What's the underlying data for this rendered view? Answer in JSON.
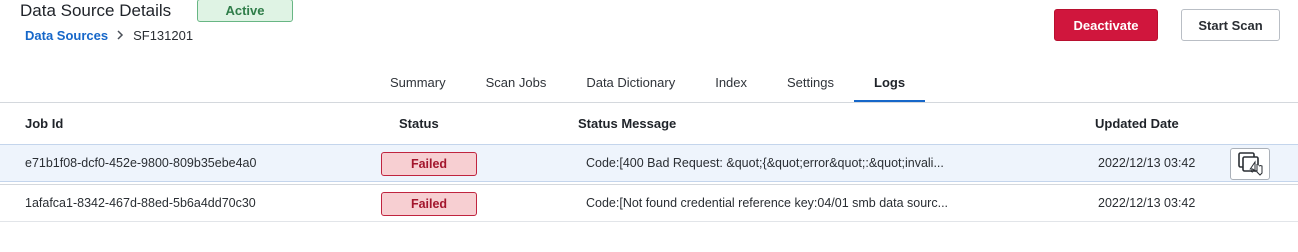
{
  "header": {
    "title": "Data Source Details",
    "status": "Active",
    "breadcrumb": {
      "parent": "Data Sources",
      "separator": ">",
      "current": "SF131201"
    },
    "buttons": {
      "deactivate": "Deactivate",
      "start_scan": "Start Scan"
    }
  },
  "tabs": [
    {
      "label": "Summary",
      "active": false
    },
    {
      "label": "Scan Jobs",
      "active": false
    },
    {
      "label": "Data Dictionary",
      "active": false
    },
    {
      "label": "Index",
      "active": false
    },
    {
      "label": "Settings",
      "active": false
    },
    {
      "label": "Logs",
      "active": true
    }
  ],
  "table": {
    "columns": [
      "Job Id",
      "Status",
      "Status Message",
      "Updated Date"
    ],
    "rows": [
      {
        "job_id": "e71b1f08-dcf0-452e-9800-809b35ebe4a0",
        "status": "Failed",
        "message": "Code:[400 Bad Request: &quot;{&quot;error&quot;:&quot;invali...",
        "updated": "2022/12/13 03:42",
        "selected": true,
        "action_icon": "copy-icon"
      },
      {
        "job_id": "1afafca1-8342-467d-88ed-5b6a4dd70c30",
        "status": "Failed",
        "message": "Code:[Not found credential reference key:04/01 smb data sourc...",
        "updated": "2022/12/13 03:42",
        "selected": false
      }
    ]
  },
  "colors": {
    "accent": "#1667c9",
    "danger": "#d0163d",
    "active_green": "#2f7d49",
    "failed_red": "#a3162d",
    "selected_row": "#eef4fc"
  }
}
